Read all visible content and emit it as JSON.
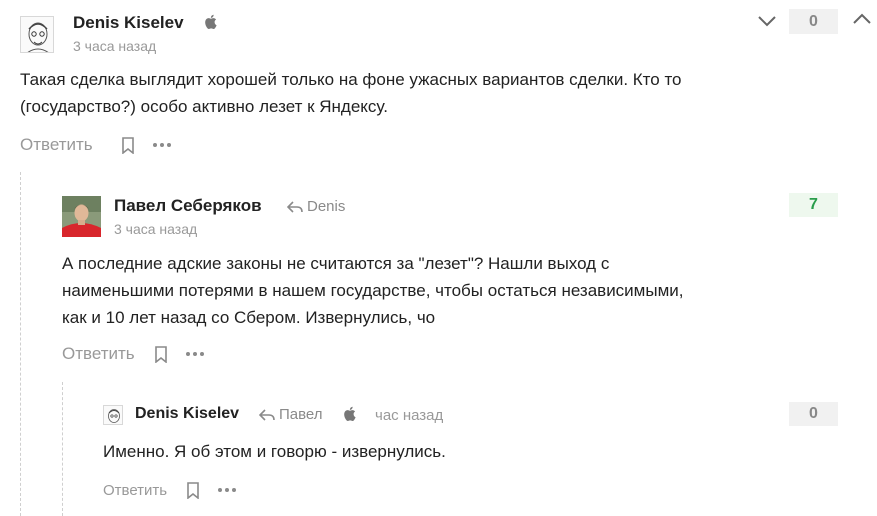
{
  "comments": [
    {
      "author": "Denis Kiselev",
      "time": "3 часа назад",
      "text": "Такая сделка выглядит хорошей только на фоне ужасных вариантов сделки. Кто то (государство?) особо активно лезет к Яндексу.",
      "score": "0",
      "reply_label": "Ответить",
      "device_icon": "apple-icon"
    },
    {
      "author": "Павел Себеряков",
      "reply_to": "Denis",
      "time": "3 часа назад",
      "text_lines": [
        "А последние адские законы не считаются за \"лезет\"? Нашли выход с",
        "наименьшими потерями в нашем государстве, чтобы остаться независимыми,",
        "как и 10 лет назад со Сбером. Извернулись, чо"
      ],
      "score": "7",
      "reply_label": "Ответить"
    },
    {
      "author": "Denis Kiselev",
      "reply_to": "Павел",
      "time": "час назад",
      "text": "Именно. Я об этом и говорю - извернулись.",
      "score": "0",
      "reply_label": "Ответить",
      "device_icon": "apple-icon"
    }
  ],
  "colors": {
    "positive_score": "#2a9d4b",
    "muted": "#999999",
    "score_bg": "#f1f1f1"
  }
}
